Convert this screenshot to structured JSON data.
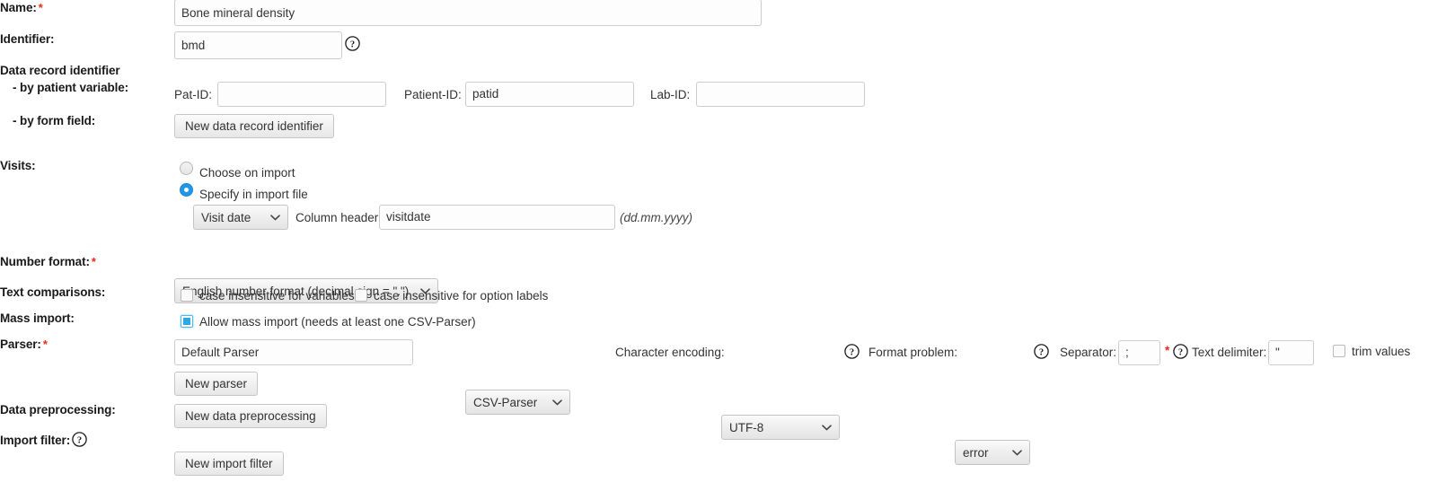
{
  "form": {
    "name": {
      "label": "Name:",
      "required": "*",
      "value": "Bone mineral density"
    },
    "identifier": {
      "label": "Identifier:",
      "value": "bmd",
      "help_icon": "help-circle-icon"
    },
    "data_record_identifier": {
      "label": "Data record identifier",
      "by_patient_variable_label": "- by patient variable:",
      "by_form_field_label": "- by form field:",
      "fields": [
        {
          "label": "Pat-ID:",
          "value": ""
        },
        {
          "label": "Patient-ID:",
          "value": "patid"
        },
        {
          "label": "Lab-ID:",
          "value": ""
        }
      ],
      "new_button": "New data record identifier"
    },
    "visits": {
      "label": "Visits:",
      "options": [
        {
          "label": "Choose on import",
          "selected": false
        },
        {
          "label": "Specify in import file",
          "selected": true
        }
      ],
      "type_select": {
        "value": "Visit date"
      },
      "column_header_label": "Column header:",
      "column_header_value": "visitdate",
      "format_hint": "(dd.mm.yyyy)"
    },
    "number_format": {
      "label": "Number format:",
      "required": "*",
      "value": "English number format (decimal sign = \".\")"
    },
    "text_comparisons": {
      "label": "Text comparisons:",
      "options": [
        {
          "label": "case insensitive for variables",
          "checked": false
        },
        {
          "label": "case insensitive for option labels",
          "checked": false
        }
      ]
    },
    "mass_import": {
      "label": "Mass import:",
      "option_label": "Allow mass import (needs at least one CSV-Parser)",
      "checked": true
    },
    "parser": {
      "label": "Parser:",
      "required": "*",
      "name_value": "Default Parser",
      "type_value": "CSV-Parser",
      "character_encoding_label": "Character encoding:",
      "character_encoding_value": "UTF-8",
      "format_problem_label": "Format problem:",
      "format_problem_value": "error",
      "separator_label": "Separator:",
      "separator_value": ";",
      "separator_required": "*",
      "text_delimiter_label": "Text delimiter:",
      "text_delimiter_value": "\"",
      "trim_values_label": "trim values",
      "trim_values_checked": false,
      "new_button": "New parser"
    },
    "data_preprocessing": {
      "label": "Data preprocessing:",
      "new_button": "New data preprocessing"
    },
    "import_filter": {
      "label": "Import filter:",
      "help_icon": "help-circle-icon",
      "new_button": "New import filter"
    }
  },
  "colors": {
    "accent": "#2196e8",
    "required": "#e8291c",
    "text": "#333333"
  }
}
